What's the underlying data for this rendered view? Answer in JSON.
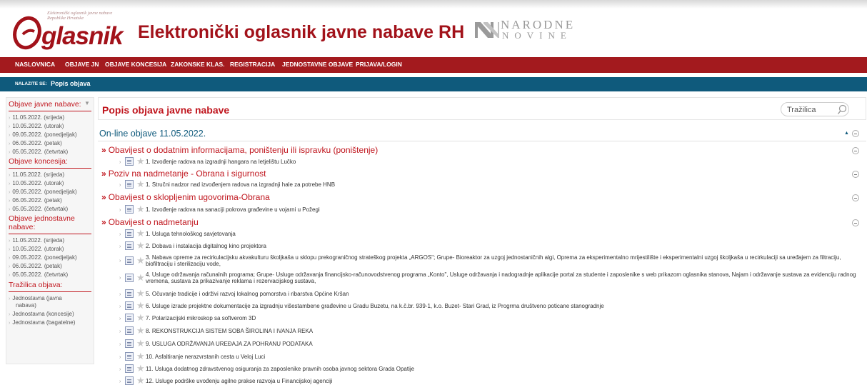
{
  "header": {
    "logo_small_text": "Elektronički oglasnik javne nabave Republike Hrvatske",
    "logo_word": "glasnik",
    "site_title": "Elektronički oglasnik javne nabave RH",
    "partner_top": "NARODNE",
    "partner_bottom": "NOVINE"
  },
  "nav": {
    "items": [
      "NASLOVNICA",
      "OBJAVE JN",
      "OBJAVE KONCESIJA",
      "ZAKONSKE KLAS.",
      "REGISTRACIJA",
      "JEDNOSTAVNE OBJAVE",
      "PRIJAVA/LOGIN"
    ]
  },
  "breadcrumb": {
    "label": "NALAZITE SE:",
    "current": "Popis objava"
  },
  "sidebar": {
    "toggle": "▼",
    "sections": [
      {
        "title": "Objave javne nabave:",
        "items": [
          "11.05.2022. (srijeda)",
          "10.05.2022. (utorak)",
          "09.05.2022. (ponedjeljak)",
          "06.05.2022. (petak)",
          "05.05.2022. (četvrtak)"
        ]
      },
      {
        "title": "Objave koncesija:",
        "items": [
          "11.05.2022. (srijeda)",
          "10.05.2022. (utorak)",
          "09.05.2022. (ponedjeljak)",
          "06.05.2022. (petak)",
          "05.05.2022. (četvrtak)"
        ]
      },
      {
        "title_line1": "Objave jednostavne",
        "title_line2": "nabave:",
        "items": [
          "11.05.2022. (srijeda)",
          "10.05.2022. (utorak)",
          "09.05.2022. (ponedjeljak)",
          "06.05.2022. (petak)",
          "05.05.2022. (četvrtak)"
        ]
      },
      {
        "title": "Tražilica objava:",
        "items": [
          "Jednostavna (javna",
          "nabava)",
          "Jednostavna (koncesije)",
          "Jednostavna (bagatelne)"
        ]
      }
    ]
  },
  "main": {
    "title": "Popis objava javne nabave",
    "search_placeholder": "Tražilica",
    "online_title": "On-line objave 11.05.2022.",
    "categories": [
      {
        "title": "Obavijest o dodatnim informacijama, poništenju ili ispravku (poništenje)",
        "items": [
          "1. Izvođenje radova na izgradnji hangara na letjelištu Lučko"
        ]
      },
      {
        "title": "Poziv na nadmetanje - Obrana i sigurnost",
        "items": [
          "1. Stručni nadzor nad izvođenjem radova na izgradnji hale za potrebe HNB"
        ]
      },
      {
        "title": "Obavijest o sklopljenim ugovorima-Obrana",
        "items": [
          "1. Izvođenje radova na sanaciji pokrova građevine u vojarni u Požegi"
        ]
      },
      {
        "title": "Obavijest o nadmetanju",
        "items": [
          "1. Usluga tehnološkog savjetovanja",
          "2. Dobava i instalacija digitalnog kino projektora",
          "3. Nabava opreme za recirkulacijsku akvakulturu školjkaša u sklopu prekograničnog strateškog projekta „ARGOS\"; Grupe- Bioreaktor za uzgoj jednostaničnih algi, Oprema za eksperimentalno mrijestilište i eksperimentalni uzgoj školjkaša u recirkulaciji sa uređajem za filtraciju, biofiltraciju i sterilizaciju vode,",
          "4. Usluge održavanja računalnih programa; Grupe- Usluge održavanja financijsko-računovodstvenog programa „Konto\", Usluge održavanja i nadogradnje aplikacije portal za studente i zaposlenike s web prikazom oglasnika stanova, Najam i održavanje sustava za evidenciju radnog vremena, sustava za prikazivanje reklama i rezervacijskog sustava,",
          "5. Očuvanje tradicije i održivi razvoj lokalnog pomorstva i ribarstva Općine Kršan",
          "6. Usluge izrade projektne dokumentacije za izgradnju višestambene građevine u Gradu Buzetu, na k.č.br. 939-1, k.o. Buzet- Stari Grad, iz Progrma društveno poticane stanogradnje",
          "7. Polarizacijski mikroskop sa softverom 3D",
          "8. REKONSTRUKCIJA SISTEM SOBA ŠIROLINA I IVANJA REKA",
          "9. USLUGA ODRŽAVANJA UREĐAJA ZA POHRANU PODATAKA",
          "10. Asfaltiranje nerazvrstanih cesta u Veloj Luci",
          "11. Usluga dodatnog zdravstvenog osiguranja za zaposlenike pravnih osoba javnog sektora Grada Opatije",
          "12. Usluge podrške uvođenju agilne prakse razvoja u Financijskoj agenciji"
        ]
      }
    ]
  },
  "colors": {
    "brand_red": "#a31a1e",
    "crumb_blue": "#0f5a7c",
    "accent_red_text": "#c0161e"
  }
}
